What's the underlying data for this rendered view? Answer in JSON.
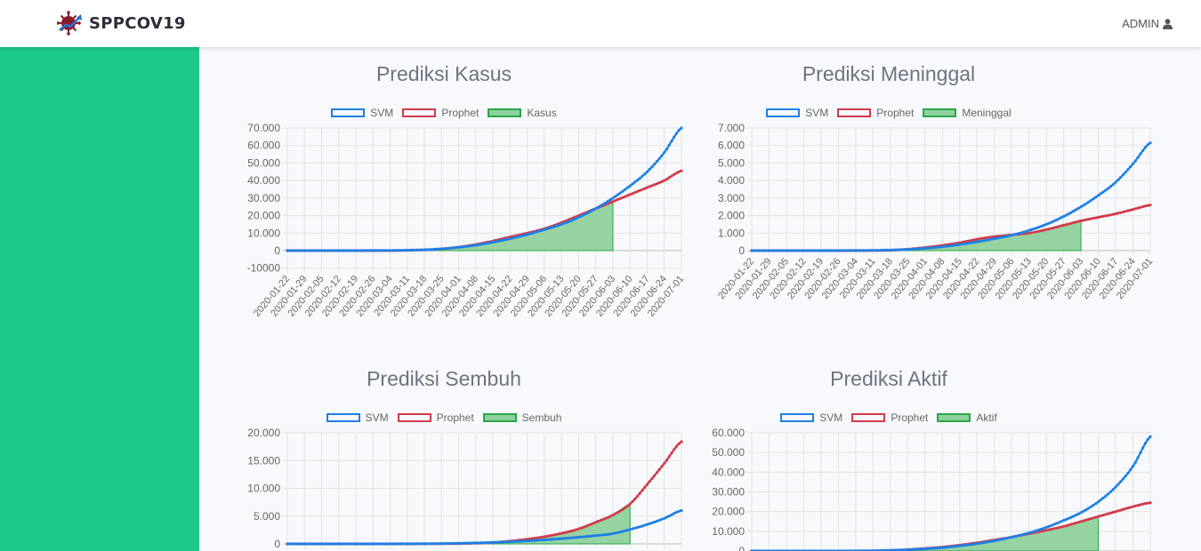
{
  "app": {
    "brand": "SPPCOV19",
    "user": "ADMIN",
    "logo_icon": "virus-chart-icon",
    "user_icon": "user-icon"
  },
  "colors": {
    "sidebar": "#1cc88a",
    "svm": "#1e7fe6",
    "prophet": "#d13b4a",
    "actual_fill": "#8fd19e",
    "actual_border": "#28a745"
  },
  "dates": [
    "2020-01-22",
    "2020-01-29",
    "2020-02-05",
    "2020-02-12",
    "2020-02-19",
    "2020-02-26",
    "2020-03-04",
    "2020-03-11",
    "2020-03-18",
    "2020-03-25",
    "2020-04-01",
    "2020-04-08",
    "2020-04-15",
    "2020-04-22",
    "2020-04-29",
    "2020-05-06",
    "2020-05-13",
    "2020-05-20",
    "2020-05-27",
    "2020-06-03",
    "2020-06-10",
    "2020-06-17",
    "2020-06-24",
    "2020-07-01"
  ],
  "chart_data": [
    {
      "title": "Prediksi Kasus",
      "type": "line",
      "legend": [
        "SVM",
        "Prophet",
        "Kasus"
      ],
      "yticks": [
        "70.000",
        "60.000",
        "50.000",
        "40.000",
        "30.000",
        "20.000",
        "10.000",
        "0",
        "-10000"
      ],
      "ylim": [
        -10000,
        70000
      ],
      "series": [
        {
          "name": "SVM",
          "values": [
            0,
            0,
            0,
            0,
            0,
            50,
            100,
            250,
            500,
            1000,
            1900,
            3100,
            4800,
            6800,
            9200,
            12000,
            15000,
            19000,
            24000,
            30000,
            37000,
            45000,
            56000,
            70000
          ]
        },
        {
          "name": "Prophet",
          "values": [
            0,
            0,
            0,
            0,
            0,
            0,
            0,
            200,
            400,
            1000,
            2000,
            3500,
            5500,
            7800,
            10000,
            12500,
            16000,
            20000,
            24000,
            28000,
            32000,
            36000,
            40000,
            45500
          ]
        },
        {
          "name": "Kasus",
          "values": [
            0,
            0,
            0,
            0,
            0,
            0,
            20,
            100,
            300,
            1000,
            2000,
            3200,
            5100,
            7500,
            10000,
            12800,
            16000,
            20000,
            24500,
            27500,
            null,
            null,
            null,
            null
          ]
        }
      ]
    },
    {
      "title": "Prediksi Meninggal",
      "type": "line",
      "legend": [
        "SVM",
        "Prophet",
        "Meninggal"
      ],
      "yticks": [
        "7.000",
        "6.000",
        "5.000",
        "4.000",
        "3.000",
        "2.000",
        "1.000",
        "0"
      ],
      "ylim": [
        -1000,
        7000
      ],
      "series": [
        {
          "name": "SVM",
          "values": [
            0,
            0,
            0,
            0,
            0,
            2,
            5,
            15,
            35,
            70,
            130,
            220,
            350,
            500,
            680,
            880,
            1150,
            1500,
            1950,
            2500,
            3150,
            3900,
            4950,
            6150
          ]
        },
        {
          "name": "Prophet",
          "values": [
            0,
            0,
            0,
            0,
            0,
            0,
            0,
            5,
            20,
            80,
            180,
            300,
            450,
            650,
            800,
            900,
            1000,
            1200,
            1450,
            1700,
            1900,
            2100,
            2350,
            2600
          ]
        },
        {
          "name": "Meninggal",
          "values": [
            0,
            0,
            0,
            0,
            0,
            0,
            0,
            5,
            20,
            80,
            180,
            300,
            450,
            650,
            800,
            900,
            1000,
            1200,
            1450,
            1700,
            null,
            null,
            null,
            null
          ]
        }
      ]
    },
    {
      "title": "Prediksi Sembuh",
      "type": "line",
      "legend": [
        "SVM",
        "Prophet",
        "Sembuh"
      ],
      "yticks": [
        "20.000",
        "15.000",
        "10.000",
        "5.000",
        "0"
      ],
      "ylim": [
        0,
        20000
      ],
      "series": [
        {
          "name": "SVM",
          "values": [
            0,
            0,
            0,
            0,
            0,
            0,
            5,
            15,
            30,
            60,
            110,
            180,
            270,
            390,
            540,
            730,
            950,
            1200,
            1500,
            1850,
            2600,
            3500,
            4600,
            6000
          ]
        },
        {
          "name": "Prophet",
          "values": [
            0,
            0,
            0,
            0,
            0,
            0,
            0,
            5,
            15,
            30,
            60,
            120,
            250,
            500,
            850,
            1300,
            1900,
            2700,
            3900,
            5200,
            7200,
            10700,
            14500,
            18400
          ]
        },
        {
          "name": "Sembuh",
          "values": [
            0,
            0,
            0,
            0,
            0,
            0,
            0,
            5,
            15,
            30,
            60,
            120,
            250,
            500,
            850,
            1300,
            1900,
            2700,
            3900,
            5200,
            7200,
            null,
            null,
            null
          ]
        }
      ]
    },
    {
      "title": "Prediksi Aktif",
      "type": "line",
      "legend": [
        "SVM",
        "Prophet",
        "Aktif"
      ],
      "yticks": [
        "60.000",
        "50.000",
        "40.000",
        "30.000",
        "20.000",
        "10.000",
        "0"
      ],
      "ylim": [
        0,
        60000
      ],
      "series": [
        {
          "name": "SVM",
          "values": [
            0,
            0,
            0,
            0,
            0,
            0,
            50,
            150,
            350,
            650,
            1100,
            1700,
            2600,
            3700,
            5200,
            7000,
            9200,
            12000,
            15500,
            19500,
            25000,
            32500,
            43000,
            58000
          ]
        },
        {
          "name": "Prophet",
          "values": [
            0,
            0,
            0,
            0,
            0,
            0,
            0,
            100,
            300,
            700,
            1300,
            2000,
            3000,
            4200,
            5600,
            7100,
            8800,
            10500,
            12500,
            15000,
            17500,
            20000,
            22500,
            24500
          ]
        },
        {
          "name": "Aktif",
          "values": [
            0,
            0,
            0,
            0,
            0,
            0,
            0,
            100,
            300,
            700,
            1300,
            2000,
            3000,
            4200,
            5600,
            7100,
            8800,
            10500,
            12500,
            15000,
            17500,
            null,
            null,
            null
          ]
        }
      ]
    }
  ]
}
